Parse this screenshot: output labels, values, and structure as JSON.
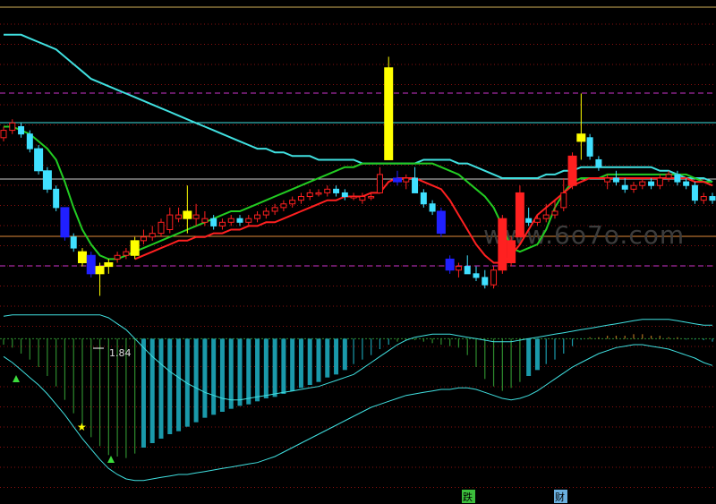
{
  "chart_data": {
    "type": "candlestick",
    "price_axis": {
      "min": 1.7,
      "max": 2.62
    },
    "osc_axis": {
      "min": -1.0,
      "max": 0.2
    },
    "annotations": {
      "low_price_label": "1.84"
    },
    "watermark": "www.6o7o.com",
    "footer_badges": [
      "跌",
      "财"
    ],
    "colors": {
      "background": "#000000",
      "up": "#ff2020",
      "down": "#40e0ff",
      "big_down": "#2020ff",
      "special": "#ffff00",
      "ma_fast": "#ff2020",
      "ma_green": "#22cc22",
      "ma_cyan": "#40e0e0",
      "grid": "#8a1010",
      "boundary_magenta": "#cc33cc",
      "hist_neg": "#1a99aa",
      "hist_neg_green": "#2d8a2d",
      "hist_pos": "#b07020"
    },
    "candles": [
      {
        "o": 2.27,
        "h": 2.3,
        "l": 2.26,
        "c": 2.29,
        "t": "up"
      },
      {
        "o": 2.29,
        "h": 2.32,
        "l": 2.28,
        "c": 2.31,
        "t": "up"
      },
      {
        "o": 2.3,
        "h": 2.31,
        "l": 2.27,
        "c": 2.28,
        "t": "down"
      },
      {
        "o": 2.28,
        "h": 2.29,
        "l": 2.23,
        "c": 2.24,
        "t": "down"
      },
      {
        "o": 2.24,
        "h": 2.25,
        "l": 2.17,
        "c": 2.18,
        "t": "down"
      },
      {
        "o": 2.18,
        "h": 2.19,
        "l": 2.12,
        "c": 2.13,
        "t": "down"
      },
      {
        "o": 2.13,
        "h": 2.14,
        "l": 2.07,
        "c": 2.08,
        "t": "down"
      },
      {
        "o": 2.08,
        "h": 2.08,
        "l": 1.99,
        "c": 2.0,
        "t": "bigdown"
      },
      {
        "o": 2.0,
        "h": 2.01,
        "l": 1.96,
        "c": 1.97,
        "t": "down"
      },
      {
        "o": 1.96,
        "h": 1.97,
        "l": 1.92,
        "c": 1.93,
        "t": "special"
      },
      {
        "o": 1.95,
        "h": 1.96,
        "l": 1.89,
        "c": 1.9,
        "t": "bigdown"
      },
      {
        "o": 1.9,
        "h": 1.93,
        "l": 1.84,
        "c": 1.92,
        "t": "special"
      },
      {
        "o": 1.92,
        "h": 1.94,
        "l": 1.9,
        "c": 1.93,
        "t": "special"
      },
      {
        "o": 1.94,
        "h": 1.96,
        "l": 1.93,
        "c": 1.95,
        "t": "up"
      },
      {
        "o": 1.95,
        "h": 1.97,
        "l": 1.94,
        "c": 1.96,
        "t": "up"
      },
      {
        "o": 1.95,
        "h": 2.0,
        "l": 1.94,
        "c": 1.99,
        "t": "special"
      },
      {
        "o": 1.99,
        "h": 2.02,
        "l": 1.98,
        "c": 2.0,
        "t": "up"
      },
      {
        "o": 2.0,
        "h": 2.03,
        "l": 1.99,
        "c": 2.01,
        "t": "up"
      },
      {
        "o": 2.01,
        "h": 2.05,
        "l": 2.0,
        "c": 2.04,
        "t": "up"
      },
      {
        "o": 2.02,
        "h": 2.08,
        "l": 2.01,
        "c": 2.06,
        "t": "up"
      },
      {
        "o": 2.06,
        "h": 2.08,
        "l": 2.04,
        "c": 2.05,
        "t": "up"
      },
      {
        "o": 2.05,
        "h": 2.14,
        "l": 2.01,
        "c": 2.07,
        "t": "special"
      },
      {
        "o": 2.05,
        "h": 2.09,
        "l": 2.03,
        "c": 2.06,
        "t": "up"
      },
      {
        "o": 2.04,
        "h": 2.07,
        "l": 2.03,
        "c": 2.05,
        "t": "up"
      },
      {
        "o": 2.05,
        "h": 2.06,
        "l": 2.02,
        "c": 2.03,
        "t": "down"
      },
      {
        "o": 2.03,
        "h": 2.05,
        "l": 2.02,
        "c": 2.04,
        "t": "up"
      },
      {
        "o": 2.04,
        "h": 2.06,
        "l": 2.03,
        "c": 2.05,
        "t": "up"
      },
      {
        "o": 2.05,
        "h": 2.06,
        "l": 2.03,
        "c": 2.04,
        "t": "down"
      },
      {
        "o": 2.04,
        "h": 2.06,
        "l": 2.03,
        "c": 2.05,
        "t": "up"
      },
      {
        "o": 2.05,
        "h": 2.07,
        "l": 2.04,
        "c": 2.06,
        "t": "up"
      },
      {
        "o": 2.06,
        "h": 2.08,
        "l": 2.05,
        "c": 2.07,
        "t": "up"
      },
      {
        "o": 2.07,
        "h": 2.09,
        "l": 2.06,
        "c": 2.08,
        "t": "up"
      },
      {
        "o": 2.08,
        "h": 2.1,
        "l": 2.07,
        "c": 2.09,
        "t": "up"
      },
      {
        "o": 2.09,
        "h": 2.11,
        "l": 2.08,
        "c": 2.1,
        "t": "up"
      },
      {
        "o": 2.1,
        "h": 2.12,
        "l": 2.09,
        "c": 2.11,
        "t": "up"
      },
      {
        "o": 2.11,
        "h": 2.13,
        "l": 2.1,
        "c": 2.12,
        "t": "up"
      },
      {
        "o": 2.12,
        "h": 2.13,
        "l": 2.11,
        "c": 2.12,
        "t": "up"
      },
      {
        "o": 2.12,
        "h": 2.14,
        "l": 2.11,
        "c": 2.13,
        "t": "up"
      },
      {
        "o": 2.13,
        "h": 2.14,
        "l": 2.11,
        "c": 2.12,
        "t": "down"
      },
      {
        "o": 2.12,
        "h": 2.13,
        "l": 2.1,
        "c": 2.11,
        "t": "down"
      },
      {
        "o": 2.11,
        "h": 2.12,
        "l": 2.1,
        "c": 2.11,
        "t": "up"
      },
      {
        "o": 2.1,
        "h": 2.12,
        "l": 2.09,
        "c": 2.11,
        "t": "up"
      },
      {
        "o": 2.11,
        "h": 2.12,
        "l": 2.1,
        "c": 2.11,
        "t": "up"
      },
      {
        "o": 2.12,
        "h": 2.19,
        "l": 2.12,
        "c": 2.17,
        "t": "up"
      },
      {
        "o": 2.21,
        "h": 2.49,
        "l": 2.21,
        "c": 2.46,
        "t": "special"
      },
      {
        "o": 2.16,
        "h": 2.18,
        "l": 2.14,
        "c": 2.15,
        "t": "bigdown"
      },
      {
        "o": 2.15,
        "h": 2.17,
        "l": 2.13,
        "c": 2.16,
        "t": "up"
      },
      {
        "o": 2.16,
        "h": 2.19,
        "l": 2.12,
        "c": 2.12,
        "t": "down"
      },
      {
        "o": 2.12,
        "h": 2.13,
        "l": 2.08,
        "c": 2.09,
        "t": "down"
      },
      {
        "o": 2.09,
        "h": 2.1,
        "l": 2.06,
        "c": 2.07,
        "t": "down"
      },
      {
        "o": 2.07,
        "h": 2.08,
        "l": 2.0,
        "c": 2.01,
        "t": "bigdown"
      },
      {
        "o": 1.94,
        "h": 1.95,
        "l": 1.9,
        "c": 1.91,
        "t": "bigdown"
      },
      {
        "o": 1.91,
        "h": 1.93,
        "l": 1.89,
        "c": 1.92,
        "t": "up"
      },
      {
        "o": 1.92,
        "h": 1.95,
        "l": 1.9,
        "c": 1.9,
        "t": "down"
      },
      {
        "o": 1.9,
        "h": 1.92,
        "l": 1.88,
        "c": 1.89,
        "t": "down"
      },
      {
        "o": 1.89,
        "h": 1.91,
        "l": 1.86,
        "c": 1.87,
        "t": "down"
      },
      {
        "o": 1.87,
        "h": 1.92,
        "l": 1.86,
        "c": 1.91,
        "t": "up"
      },
      {
        "o": 1.91,
        "h": 2.06,
        "l": 1.9,
        "c": 2.05,
        "t": "up"
      },
      {
        "o": 1.93,
        "h": 2.0,
        "l": 1.92,
        "c": 1.99,
        "t": "up"
      },
      {
        "o": 2.0,
        "h": 2.14,
        "l": 2.0,
        "c": 2.12,
        "t": "up"
      },
      {
        "o": 2.05,
        "h": 2.08,
        "l": 2.03,
        "c": 2.04,
        "t": "down"
      },
      {
        "o": 2.04,
        "h": 2.06,
        "l": 2.03,
        "c": 2.05,
        "t": "up"
      },
      {
        "o": 2.05,
        "h": 2.09,
        "l": 2.04,
        "c": 2.06,
        "t": "up"
      },
      {
        "o": 2.06,
        "h": 2.1,
        "l": 2.05,
        "c": 2.07,
        "t": "up"
      },
      {
        "o": 2.08,
        "h": 2.16,
        "l": 2.07,
        "c": 2.12,
        "t": "up"
      },
      {
        "o": 2.14,
        "h": 2.23,
        "l": 2.13,
        "c": 2.22,
        "t": "up"
      },
      {
        "o": 2.26,
        "h": 2.39,
        "l": 2.21,
        "c": 2.28,
        "t": "special"
      },
      {
        "o": 2.27,
        "h": 2.28,
        "l": 2.21,
        "c": 2.22,
        "t": "down"
      },
      {
        "o": 2.21,
        "h": 2.22,
        "l": 2.18,
        "c": 2.19,
        "t": "down"
      },
      {
        "o": 2.15,
        "h": 2.17,
        "l": 2.13,
        "c": 2.16,
        "t": "up"
      },
      {
        "o": 2.16,
        "h": 2.18,
        "l": 2.14,
        "c": 2.15,
        "t": "down"
      },
      {
        "o": 2.14,
        "h": 2.16,
        "l": 2.12,
        "c": 2.13,
        "t": "down"
      },
      {
        "o": 2.13,
        "h": 2.15,
        "l": 2.12,
        "c": 2.14,
        "t": "up"
      },
      {
        "o": 2.14,
        "h": 2.16,
        "l": 2.13,
        "c": 2.15,
        "t": "up"
      },
      {
        "o": 2.15,
        "h": 2.16,
        "l": 2.13,
        "c": 2.14,
        "t": "down"
      },
      {
        "o": 2.14,
        "h": 2.17,
        "l": 2.13,
        "c": 2.16,
        "t": "up"
      },
      {
        "o": 2.16,
        "h": 2.18,
        "l": 2.15,
        "c": 2.17,
        "t": "up"
      },
      {
        "o": 2.17,
        "h": 2.18,
        "l": 2.14,
        "c": 2.15,
        "t": "down"
      },
      {
        "o": 2.15,
        "h": 2.16,
        "l": 2.13,
        "c": 2.14,
        "t": "down"
      },
      {
        "o": 2.14,
        "h": 2.15,
        "l": 2.09,
        "c": 2.1,
        "t": "down"
      },
      {
        "o": 2.1,
        "h": 2.12,
        "l": 2.09,
        "c": 2.11,
        "t": "up"
      },
      {
        "o": 2.11,
        "h": 2.12,
        "l": 2.09,
        "c": 2.1,
        "t": "down"
      }
    ],
    "ma_fast": [
      null,
      null,
      null,
      null,
      null,
      null,
      null,
      null,
      null,
      null,
      null,
      null,
      null,
      null,
      null,
      1.94,
      1.95,
      1.96,
      1.97,
      1.98,
      1.99,
      1.99,
      2.0,
      2.0,
      2.01,
      2.01,
      2.02,
      2.02,
      2.03,
      2.03,
      2.04,
      2.04,
      2.05,
      2.06,
      2.07,
      2.08,
      2.09,
      2.1,
      2.1,
      2.11,
      2.11,
      2.11,
      2.12,
      2.12,
      2.15,
      2.16,
      2.16,
      2.16,
      2.15,
      2.14,
      2.13,
      2.1,
      2.06,
      2.02,
      1.98,
      1.95,
      1.93,
      1.93,
      1.95,
      1.98,
      2.02,
      2.06,
      2.08,
      2.1,
      2.12,
      2.14,
      2.15,
      2.16,
      2.16,
      2.16,
      2.16,
      2.16,
      2.16,
      2.16,
      2.16,
      2.16,
      2.16,
      2.16,
      2.16,
      2.15,
      2.15,
      2.14
    ],
    "ma_green": [
      2.3,
      2.3,
      2.29,
      2.28,
      2.26,
      2.24,
      2.21,
      2.15,
      2.08,
      2.02,
      1.98,
      1.95,
      1.94,
      1.94,
      1.95,
      1.96,
      1.97,
      1.98,
      1.99,
      2.0,
      2.01,
      2.02,
      2.03,
      2.04,
      2.05,
      2.06,
      2.07,
      2.07,
      2.08,
      2.09,
      2.1,
      2.11,
      2.12,
      2.13,
      2.14,
      2.15,
      2.16,
      2.17,
      2.18,
      2.19,
      2.19,
      2.2,
      2.2,
      2.2,
      2.2,
      2.2,
      2.2,
      2.2,
      2.2,
      2.2,
      2.19,
      2.18,
      2.17,
      2.15,
      2.13,
      2.11,
      2.08,
      2.03,
      1.97,
      1.96,
      1.97,
      1.98,
      2.02,
      2.08,
      2.12,
      2.15,
      2.16,
      2.16,
      2.16,
      2.17,
      2.17,
      2.17,
      2.17,
      2.17,
      2.17,
      2.17,
      2.17,
      2.17,
      2.17,
      2.16,
      2.15,
      2.15
    ],
    "ma_cyan": [
      2.55,
      2.55,
      2.55,
      2.54,
      2.53,
      2.52,
      2.51,
      2.49,
      2.47,
      2.45,
      2.43,
      2.42,
      2.41,
      2.4,
      2.39,
      2.38,
      2.37,
      2.36,
      2.35,
      2.34,
      2.33,
      2.32,
      2.31,
      2.3,
      2.29,
      2.28,
      2.27,
      2.26,
      2.25,
      2.24,
      2.24,
      2.23,
      2.23,
      2.22,
      2.22,
      2.22,
      2.21,
      2.21,
      2.21,
      2.21,
      2.21,
      2.2,
      2.2,
      2.2,
      2.2,
      2.2,
      2.2,
      2.2,
      2.21,
      2.21,
      2.21,
      2.21,
      2.2,
      2.2,
      2.19,
      2.18,
      2.17,
      2.16,
      2.16,
      2.16,
      2.16,
      2.16,
      2.17,
      2.17,
      2.18,
      2.18,
      2.19,
      2.19,
      2.19,
      2.19,
      2.19,
      2.19,
      2.19,
      2.19,
      2.19,
      2.18,
      2.18,
      2.17,
      2.16,
      2.16,
      2.16,
      2.15
    ],
    "hist": [
      -0.04,
      -0.06,
      -0.1,
      -0.14,
      -0.19,
      -0.25,
      -0.32,
      -0.41,
      -0.5,
      -0.59,
      -0.66,
      -0.72,
      -0.78,
      -0.79,
      -0.8,
      -0.77,
      -0.73,
      -0.7,
      -0.67,
      -0.64,
      -0.62,
      -0.59,
      -0.56,
      -0.53,
      -0.51,
      -0.49,
      -0.47,
      -0.45,
      -0.44,
      -0.42,
      -0.4,
      -0.39,
      -0.37,
      -0.35,
      -0.33,
      -0.31,
      -0.29,
      -0.26,
      -0.24,
      -0.21,
      -0.17,
      -0.14,
      -0.11,
      -0.07,
      -0.04,
      -0.02,
      -0.01,
      -0.01,
      -0.02,
      -0.03,
      -0.04,
      -0.05,
      -0.06,
      -0.11,
      -0.19,
      -0.27,
      -0.32,
      -0.35,
      -0.33,
      -0.29,
      -0.25,
      -0.21,
      -0.17,
      -0.14,
      -0.1,
      -0.05,
      0.0,
      0.01,
      0.01,
      0.02,
      0.02,
      0.02,
      0.03,
      0.03,
      0.02,
      0.02,
      0.01,
      0.01,
      0.0,
      0.0,
      -0.01,
      -0.02
    ],
    "osc_upper": [
      0.15,
      0.16,
      0.16,
      0.16,
      0.16,
      0.16,
      0.16,
      0.16,
      0.16,
      0.16,
      0.16,
      0.16,
      0.14,
      0.1,
      0.06,
      0.0,
      -0.06,
      -0.12,
      -0.17,
      -0.22,
      -0.26,
      -0.3,
      -0.33,
      -0.36,
      -0.38,
      -0.4,
      -0.41,
      -0.41,
      -0.4,
      -0.39,
      -0.38,
      -0.37,
      -0.36,
      -0.35,
      -0.34,
      -0.33,
      -0.32,
      -0.3,
      -0.28,
      -0.26,
      -0.24,
      -0.2,
      -0.16,
      -0.12,
      -0.08,
      -0.04,
      -0.01,
      0.01,
      0.02,
      0.03,
      0.03,
      0.03,
      0.02,
      0.01,
      0.0,
      -0.01,
      -0.02,
      -0.02,
      -0.02,
      -0.01,
      0.0,
      0.01,
      0.02,
      0.03,
      0.04,
      0.05,
      0.06,
      0.07,
      0.08,
      0.09,
      0.1,
      0.11,
      0.12,
      0.13,
      0.13,
      0.13,
      0.13,
      0.12,
      0.11,
      0.1,
      0.09,
      0.09
    ],
    "osc_lower": [
      -0.12,
      -0.16,
      -0.21,
      -0.26,
      -0.31,
      -0.37,
      -0.44,
      -0.51,
      -0.59,
      -0.67,
      -0.74,
      -0.81,
      -0.87,
      -0.91,
      -0.94,
      -0.95,
      -0.95,
      -0.94,
      -0.93,
      -0.92,
      -0.91,
      -0.91,
      -0.9,
      -0.89,
      -0.88,
      -0.87,
      -0.86,
      -0.85,
      -0.84,
      -0.83,
      -0.81,
      -0.79,
      -0.76,
      -0.73,
      -0.7,
      -0.67,
      -0.64,
      -0.61,
      -0.58,
      -0.55,
      -0.52,
      -0.49,
      -0.46,
      -0.44,
      -0.42,
      -0.4,
      -0.38,
      -0.37,
      -0.36,
      -0.35,
      -0.34,
      -0.34,
      -0.33,
      -0.33,
      -0.34,
      -0.36,
      -0.38,
      -0.4,
      -0.41,
      -0.4,
      -0.38,
      -0.35,
      -0.31,
      -0.27,
      -0.23,
      -0.19,
      -0.16,
      -0.13,
      -0.1,
      -0.08,
      -0.06,
      -0.05,
      -0.04,
      -0.04,
      -0.05,
      -0.06,
      -0.07,
      -0.09,
      -0.11,
      -0.13,
      -0.16,
      -0.18
    ]
  }
}
